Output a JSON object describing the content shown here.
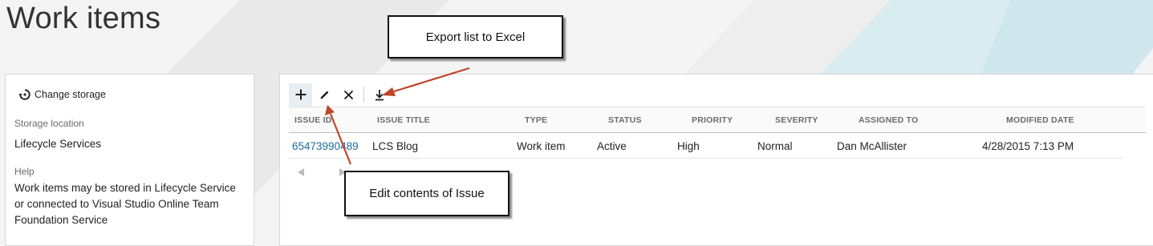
{
  "page": {
    "title": "Work items"
  },
  "sidebar": {
    "change_storage_label": "Change storage",
    "storage_location_label": "Storage location",
    "storage_location_value": "Lifecycle Services",
    "help_label": "Help",
    "help_lines": [
      "Work items may be stored in Lifecycle Service",
      "or connected to Visual Studio Online Team",
      "Foundation Service"
    ]
  },
  "toolbar": {
    "buttons": [
      {
        "name": "add",
        "icon": "plus-icon"
      },
      {
        "name": "edit",
        "icon": "pencil-icon"
      },
      {
        "name": "delete",
        "icon": "close-icon"
      },
      {
        "name": "export",
        "icon": "download-icon"
      }
    ]
  },
  "grid": {
    "columns": [
      "ISSUE ID",
      "ISSUE TITLE",
      "TYPE",
      "STATUS",
      "PRIORITY",
      "SEVERITY",
      "ASSIGNED TO",
      "MODIFIED DATE"
    ],
    "rows": [
      {
        "issue_id": "65473990489",
        "issue_title": "LCS Blog",
        "type": "Work item",
        "status": "Active",
        "priority": "High",
        "severity": "Normal",
        "assigned_to": "Dan McAllister",
        "modified_date": "4/28/2015 7:13 PM"
      }
    ]
  },
  "pager": {
    "prev_icon": "triangle-left-icon",
    "next_icon": "triangle-right-icon"
  },
  "annotations": {
    "export_label": "Export list to Excel",
    "edit_label": "Edit contents of Issue"
  },
  "colors": {
    "accent": "#1f6d9d",
    "arrow": "#c0462a",
    "stripe": "#d5e9ee"
  }
}
